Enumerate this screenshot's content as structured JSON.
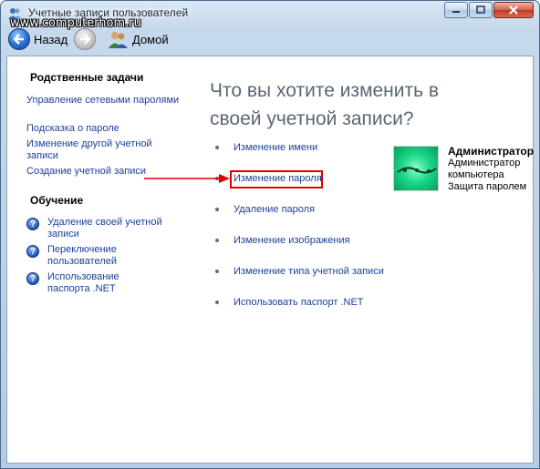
{
  "window": {
    "title": "Учетные записи пользователей",
    "watermark": "www.computerhom.ru"
  },
  "nav": {
    "back_label": "Назад",
    "home_label": "Домой"
  },
  "sidebar": {
    "related_title": "Родственные задачи",
    "related_links": [
      "Управление сетевыми паролями",
      "Подсказка о пароле",
      "Изменение другой учетной записи",
      "Создание учетной записи"
    ],
    "learn_title": "Обучение",
    "learn_links": [
      "Удаление своей учетной записи",
      "Переключение пользователей",
      "Использование паспорта .NET"
    ]
  },
  "main": {
    "heading": "Что вы хотите изменить в своей учетной записи?",
    "actions": [
      "Изменение имени",
      "Изменение пароля",
      "Удаление пароля",
      "Изменение изображения",
      "Изменение типа учетной записи",
      "Использовать паспорт .NET"
    ],
    "highlighted_action": "Изменение пароля",
    "highlight_color": "#e00000"
  },
  "account": {
    "name": "Администратор",
    "type": "Администратор компьютера",
    "status": "Защита паролем"
  },
  "colors": {
    "link": "#1b3f9a",
    "heading": "#5a6774"
  }
}
